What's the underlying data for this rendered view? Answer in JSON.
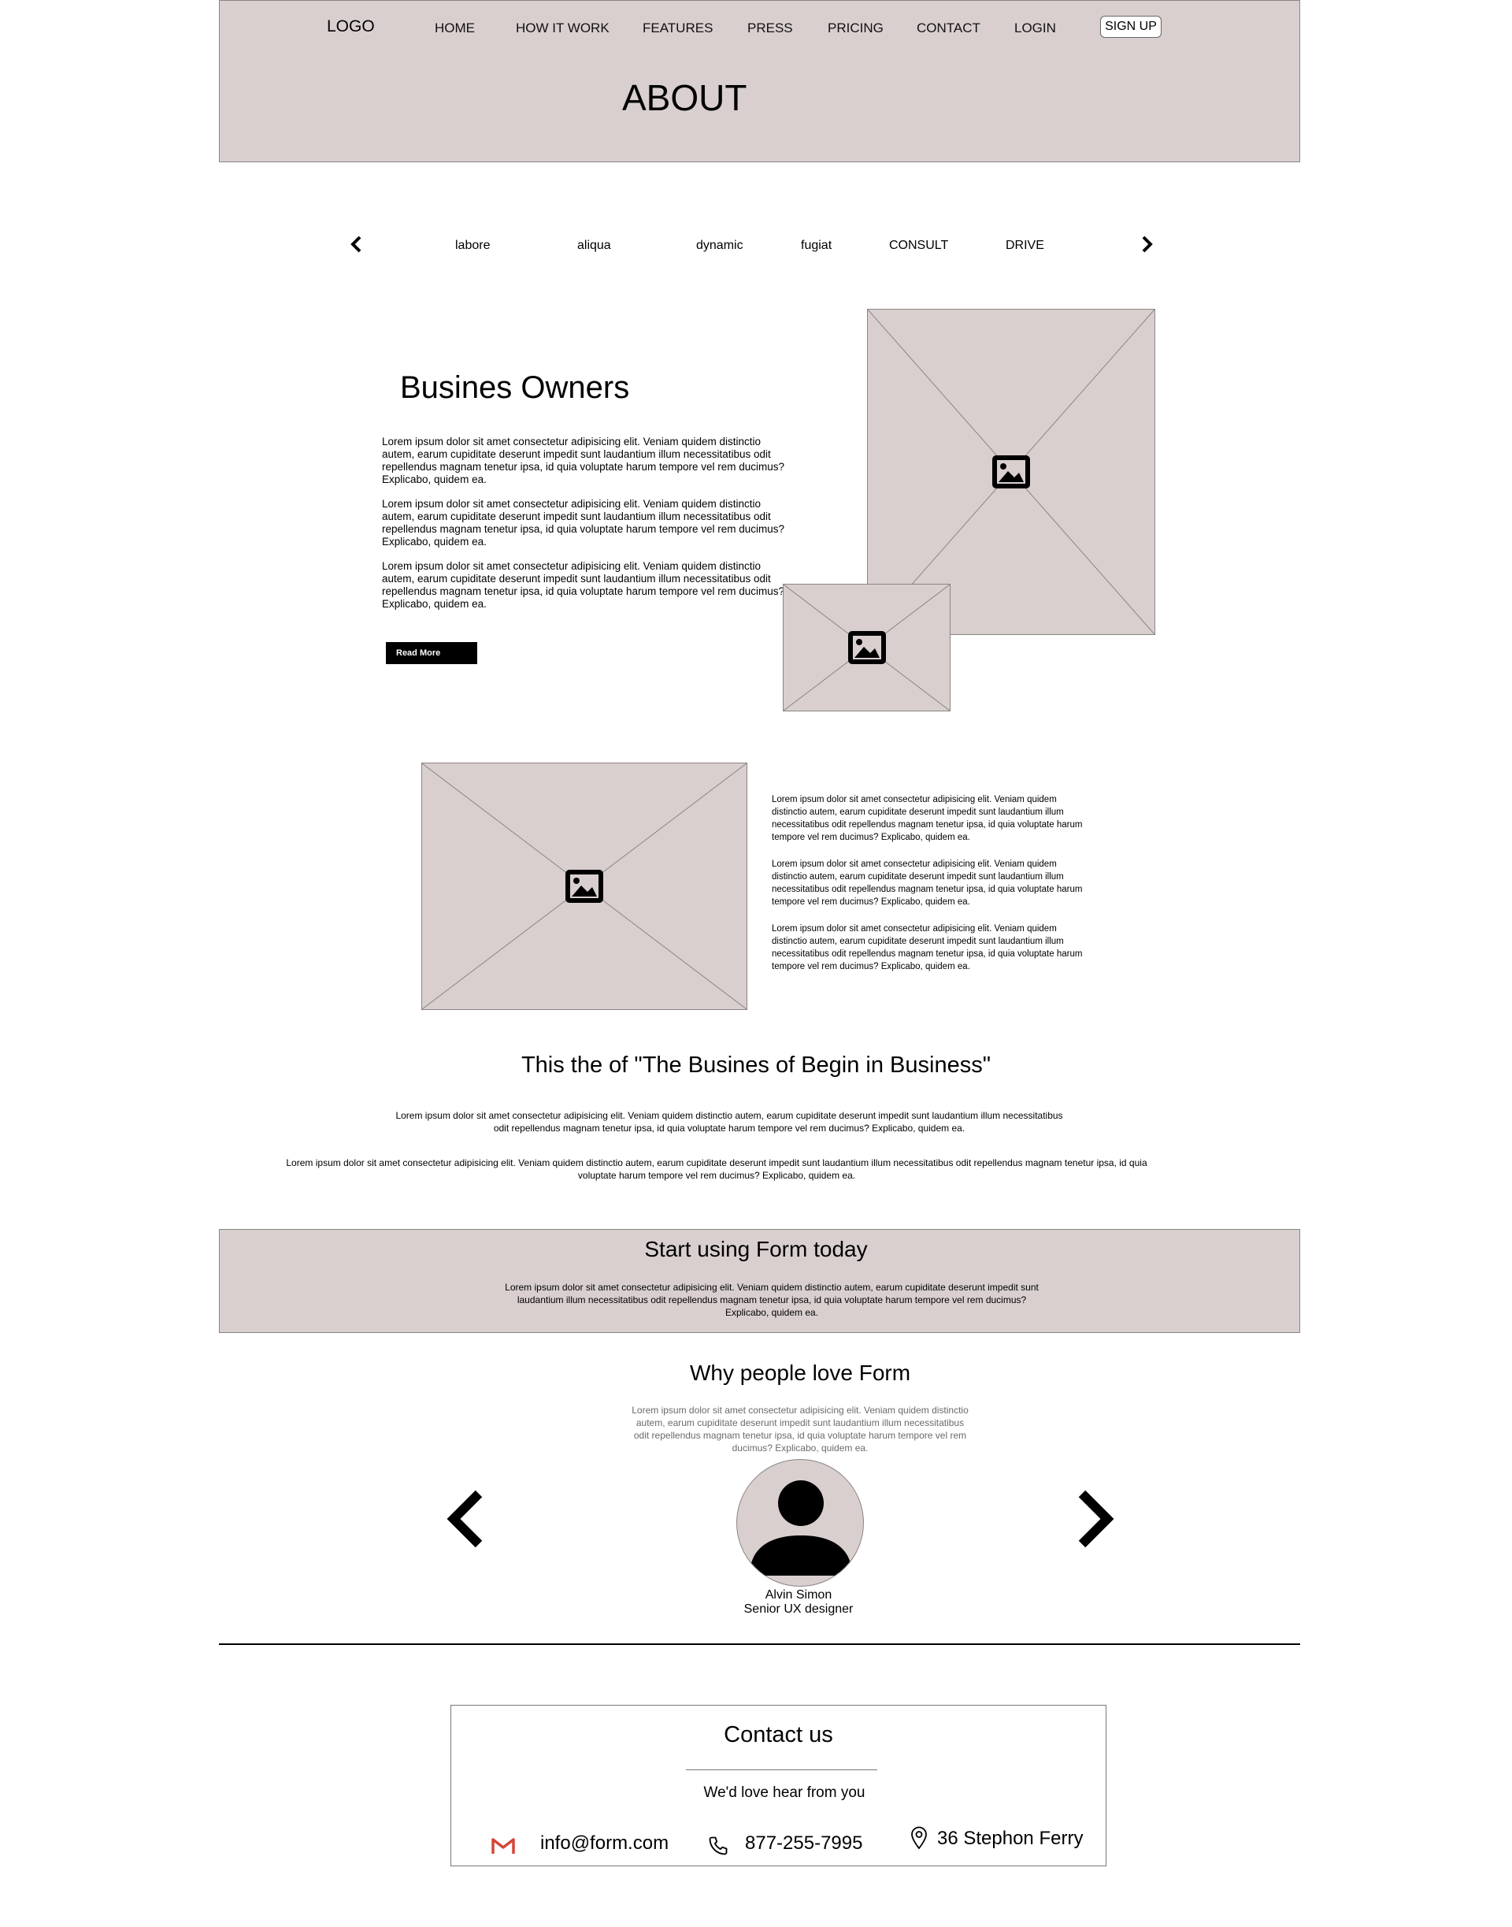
{
  "header": {
    "logo": "LOGO",
    "nav": [
      "HOME",
      "HOW IT WORK",
      "FEATURES",
      "PRESS",
      "PRICING",
      "CONTACT",
      "LOGIN"
    ],
    "signup": "SIGN UP",
    "page_title": "ABOUT"
  },
  "categories": [
    "labore",
    "aliqua",
    "dynamic",
    "fugiat",
    "CONSULT",
    "DRIVE"
  ],
  "section1": {
    "title": "Busines Owners",
    "paragraphs": [
      "Lorem ipsum dolor sit amet consectetur adipisicing elit. Veniam quidem distinctio autem, earum cupiditate deserunt impedit sunt laudantium illum necessitatibus odit repellendus magnam tenetur ipsa, id quia voluptate harum tempore vel rem ducimus? Explicabo, quidem ea.",
      "Lorem ipsum dolor sit amet consectetur adipisicing elit. Veniam quidem distinctio autem, earum cupiditate deserunt impedit sunt laudantium illum necessitatibus odit repellendus magnam tenetur ipsa, id quia voluptate harum tempore vel rem ducimus? Explicabo, quidem ea.",
      "Lorem ipsum dolor sit amet consectetur adipisicing elit. Veniam quidem distinctio autem, earum cupiditate deserunt impedit sunt laudantium illum necessitatibus odit repellendus magnam tenetur ipsa, id quia voluptate harum tempore vel rem ducimus? Explicabo, quidem ea."
    ],
    "read_more": "Read More"
  },
  "section2": {
    "paragraphs": [
      "Lorem ipsum dolor sit amet consectetur adipisicing elit. Veniam quidem distinctio autem, earum cupiditate deserunt impedit sunt laudantium illum necessitatibus odit repellendus magnam tenetur ipsa, id quia voluptate harum tempore vel rem ducimus? Explicabo, quidem ea.",
      "Lorem ipsum dolor sit amet consectetur adipisicing elit. Veniam quidem distinctio autem, earum cupiditate deserunt impedit sunt laudantium illum necessitatibus odit repellendus magnam tenetur ipsa, id quia voluptate harum tempore vel rem ducimus? Explicabo, quidem ea.",
      "Lorem ipsum dolor sit amet consectetur adipisicing elit. Veniam quidem distinctio autem, earum cupiditate deserunt impedit sunt laudantium illum necessitatibus odit repellendus magnam tenetur ipsa, id quia voluptate harum tempore vel rem ducimus? Explicabo, quidem ea."
    ]
  },
  "section3": {
    "title": "This the of \"The Busines of Begin in Business\"",
    "p1": "Lorem ipsum dolor sit amet consectetur adipisicing elit. Veniam quidem distinctio autem, earum cupiditate deserunt impedit sunt laudantium illum necessitatibus odit repellendus magnam tenetur ipsa, id quia voluptate harum tempore vel rem ducimus? Explicabo, quidem ea.",
    "p2": "Lorem ipsum dolor sit amet consectetur adipisicing elit. Veniam quidem distinctio autem, earum cupiditate deserunt impedit sunt laudantium illum necessitatibus odit repellendus magnam tenetur ipsa, id quia voluptate harum tempore vel rem ducimus? Explicabo, quidem ea."
  },
  "cta": {
    "title": "Start using Form today",
    "text": "Lorem ipsum dolor sit amet consectetur adipisicing elit. Veniam quidem distinctio autem, earum cupiditate deserunt impedit sunt laudantium illum necessitatibus odit repellendus magnam tenetur ipsa, id quia voluptate harum tempore vel rem ducimus? Explicabo, quidem ea."
  },
  "testimonials": {
    "title": "Why people love Form",
    "text": "Lorem ipsum dolor sit amet consectetur adipisicing elit. Veniam quidem distinctio autem, earum cupiditate deserunt impedit sunt laudantium illum necessitatibus odit repellendus magnam tenetur ipsa, id quia voluptate harum tempore vel rem ducimus? Explicabo, quidem ea.",
    "name": "Alvin Simon",
    "role": "Senior UX designer"
  },
  "contact": {
    "title": "Contact us",
    "subtitle": "We'd love hear from you",
    "email": "info@form.com",
    "phone": "877-255-7995",
    "address": "36 Stephon Ferry",
    "icons": [
      "gmail-icon",
      "phone-icon",
      "location-pin-icon"
    ]
  },
  "colors": {
    "placeholder_bg": "#d9cfcf",
    "border": "#8c8484"
  }
}
